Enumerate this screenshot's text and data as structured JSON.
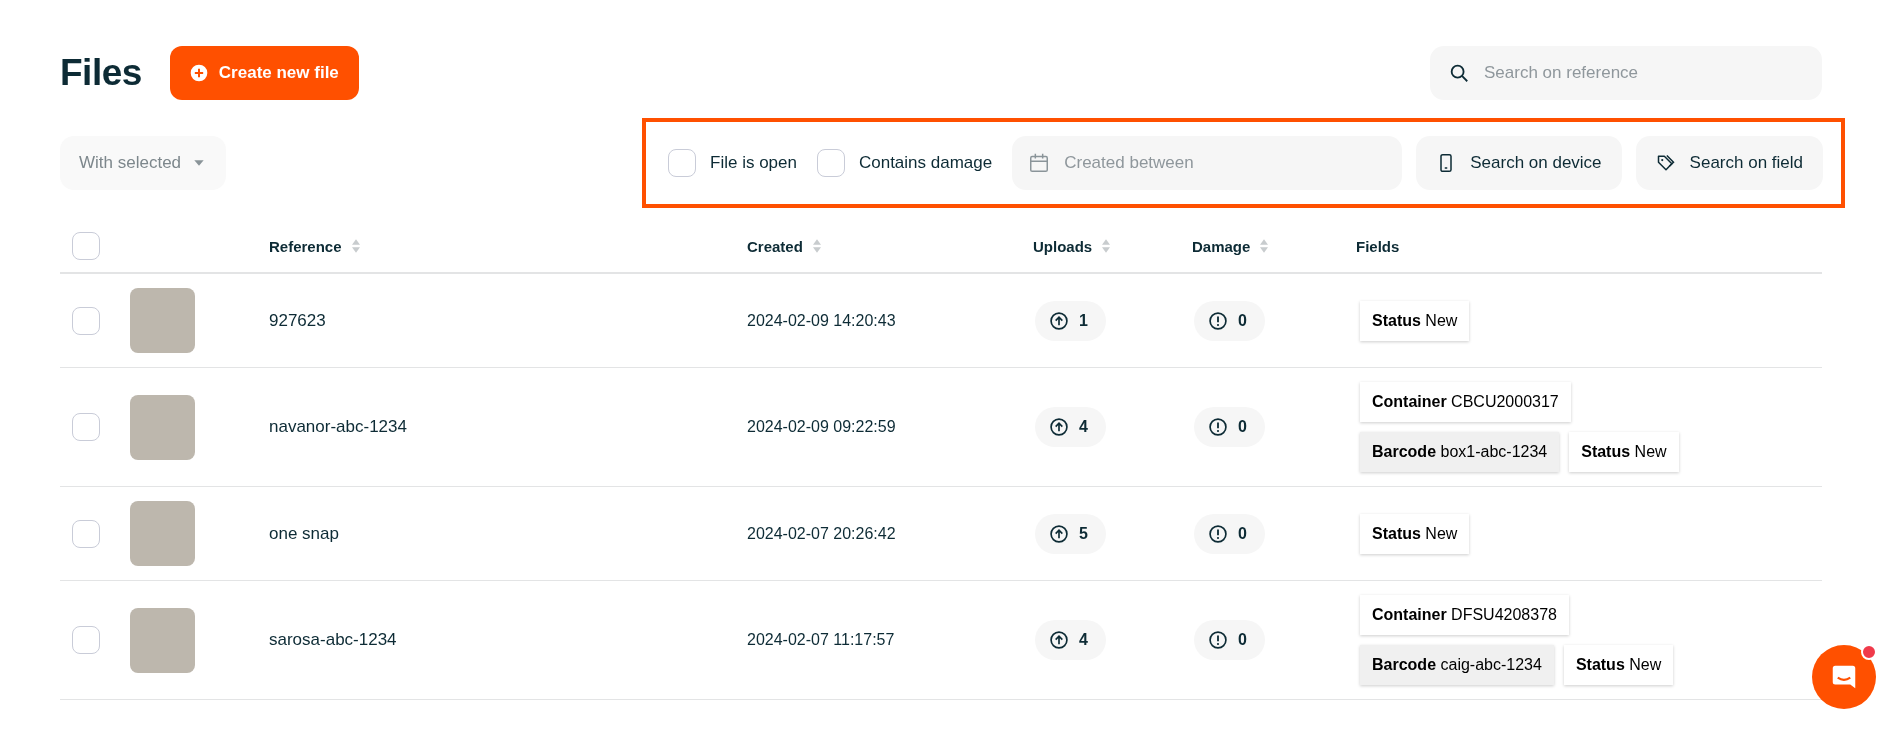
{
  "title": "Files",
  "create_button": {
    "label": "Create new file"
  },
  "search": {
    "placeholder": "Search on reference"
  },
  "bulk_action": {
    "label": "With selected"
  },
  "filters": {
    "checkboxes": [
      {
        "label": "File is open",
        "checked": false
      },
      {
        "label": "Contains damage",
        "checked": false
      }
    ],
    "date_range": {
      "placeholder": "Created between"
    },
    "buttons": [
      {
        "label": "Search on device",
        "kind": "device"
      },
      {
        "label": "Search on field",
        "kind": "tag"
      }
    ]
  },
  "table": {
    "select_all_checked": false,
    "columns": [
      {
        "label": "Reference",
        "sortable": true
      },
      {
        "label": "Created",
        "sortable": true
      },
      {
        "label": "Uploads",
        "sortable": true
      },
      {
        "label": "Damage",
        "sortable": true
      },
      {
        "label": "Fields",
        "sortable": false
      }
    ],
    "rows": [
      {
        "checked": false,
        "reference": "927623",
        "created": "2024-02-09 14:20:43",
        "uploads": "1",
        "damage": "0",
        "field_lines": [
          [
            {
              "name": "Status",
              "value": "New",
              "shaded": false
            }
          ]
        ]
      },
      {
        "checked": false,
        "reference": "navanor-abc-1234",
        "created": "2024-02-09 09:22:59",
        "uploads": "4",
        "damage": "0",
        "field_lines": [
          [
            {
              "name": "Container",
              "value": "CBCU2000317",
              "shaded": false
            }
          ],
          [
            {
              "name": "Barcode",
              "value": "box1-abc-1234",
              "shaded": true
            },
            {
              "name": "Status",
              "value": "New",
              "shaded": false
            }
          ]
        ]
      },
      {
        "checked": false,
        "reference": "one snap",
        "created": "2024-02-07 20:26:42",
        "uploads": "5",
        "damage": "0",
        "field_lines": [
          [
            {
              "name": "Status",
              "value": "New",
              "shaded": false
            }
          ]
        ]
      },
      {
        "checked": false,
        "reference": "sarosa-abc-1234",
        "created": "2024-02-07 11:17:57",
        "uploads": "4",
        "damage": "0",
        "field_lines": [
          [
            {
              "name": "Container",
              "value": "DFSU4208378",
              "shaded": false
            }
          ],
          [
            {
              "name": "Barcode",
              "value": "caig-abc-1234",
              "shaded": true
            },
            {
              "name": "Status",
              "value": "New",
              "shaded": false
            }
          ]
        ]
      }
    ]
  },
  "chat_launcher": {
    "unread": true
  }
}
